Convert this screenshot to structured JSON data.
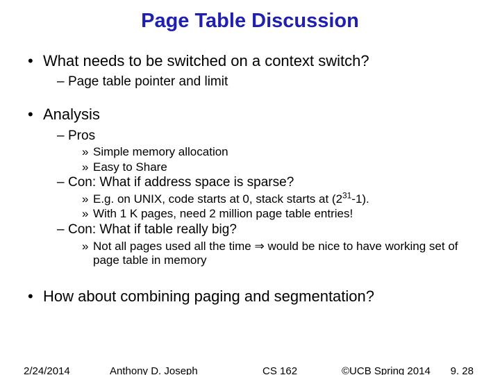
{
  "title": "Page Table Discussion",
  "bullets": {
    "b1_q1": "What needs to be switched on a context switch?",
    "b2_q1a": "Page table pointer and limit",
    "b1_an": "Analysis",
    "b2_pros": "Pros",
    "b3_pros1": "Simple memory allocation",
    "b3_pros2": "Easy to Share",
    "b2_con1": "Con: What if address space is sparse?",
    "b3_con1a_pre": "E.g. on UNIX, code starts at 0, stack starts at (2",
    "b3_con1a_sup": "31",
    "b3_con1a_post": "-1).",
    "b3_con1b": "With 1 K pages, need 2 million page table entries!",
    "b2_con2": "Con: What if table really big?",
    "b3_con2a_pre": "Not all pages used all the time ",
    "b3_con2a_post": " would be nice to have working set of page table in memory",
    "b1_final": "How about combining paging and segmentation?"
  },
  "footer": {
    "date": "2/24/2014",
    "author": "Anthony D. Joseph",
    "course": "CS 162",
    "copyright": "©UCB Spring 2014",
    "page": "9. 28"
  }
}
